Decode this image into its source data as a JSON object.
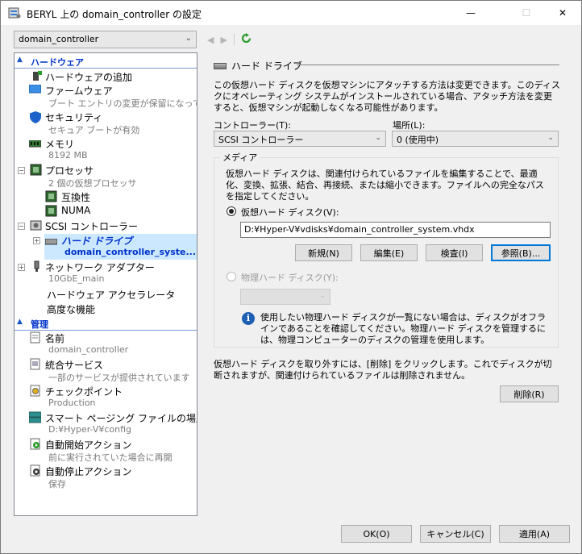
{
  "window": {
    "title": "BERYL 上の domain_controller の設定",
    "minimize": "—",
    "maximize": "☐",
    "close": "✕"
  },
  "vm_select": {
    "value": "domain_controller"
  },
  "tree": {
    "hardware_header": "ハードウェア",
    "management_header": "管理",
    "items": {
      "add_hardware": {
        "name": "ハードウェアの追加"
      },
      "firmware": {
        "name": "ファームウェア",
        "sub": "ブート エントリの変更が保留になって..."
      },
      "security": {
        "name": "セキュリティ",
        "sub": "セキュア ブートが有効"
      },
      "memory": {
        "name": "メモリ",
        "sub": "8192 MB"
      },
      "processor": {
        "name": "プロセッサ",
        "sub": "2 個の仮想プロセッサ"
      },
      "compat": {
        "name": "互換性"
      },
      "numa": {
        "name": "NUMA"
      },
      "scsi": {
        "name": "SCSI コントローラー"
      },
      "hdd": {
        "name": "ハード ドライブ",
        "sub": "domain_controller_syste..."
      },
      "nic": {
        "name": "ネットワーク アダプター",
        "sub": "10GbE_main"
      },
      "hw_accel": {
        "name": "ハードウェア アクセラレータ"
      },
      "advanced": {
        "name": "高度な機能"
      },
      "vm_name": {
        "name": "名前",
        "sub": "domain_controller"
      },
      "integration": {
        "name": "統合サービス",
        "sub": "一部のサービスが提供されています"
      },
      "checkpoint": {
        "name": "チェックポイント",
        "sub": "Production"
      },
      "paging": {
        "name": "スマート ページング ファイルの場所",
        "sub": "D:¥Hyper-V¥config"
      },
      "autostart": {
        "name": "自動開始アクション",
        "sub": "前に実行されていた場合に再開"
      },
      "autostop": {
        "name": "自動停止アクション",
        "sub": "保存"
      }
    }
  },
  "panel": {
    "title": "ハード ドライブ",
    "description": "この仮想ハード ディスクを仮想マシンにアタッチする方法は変更できます。このディスクにオペレーティング システムがインストールされている場合、アタッチ方法を変更すると、仮想マシンが起動しなくなる可能性があります。",
    "controller_label": "コントローラー(T):",
    "controller_value": "SCSI コントローラー",
    "location_label": "場所(L):",
    "location_value": "0 (使用中)",
    "media_legend": "メディア",
    "media_desc": "仮想ハード ディスクは、関連付けられているファイルを編集することで、最適化、変換、拡張、結合、再接続、または縮小できます。ファイルへの完全なパスを指定してください。",
    "vhd_radio": "仮想ハード ディスク(V):",
    "vhd_path": "D:¥Hyper-V¥vdisks¥domain_controller_system.vhdx",
    "btn_new": "新規(N)",
    "btn_edit": "編集(E)",
    "btn_inspect": "検査(I)",
    "btn_browse": "参照(B)...",
    "phys_radio": "物理ハード ディスク(Y):",
    "info_text": "使用したい物理ハード ディスクが一覧にない場合は、ディスクがオフラインであることを確認してください。物理ハード ディスクを管理するには、物理コンピューターのディスクの管理を使用します。",
    "remove_text": "仮想ハード ディスクを取り外すには、[削除] をクリックします。これでディスクが切断されますが、関連付けられているファイルは削除されません。",
    "btn_remove": "削除(R)"
  },
  "footer": {
    "ok": "OK(O)",
    "cancel": "キャンセル(C)",
    "apply": "適用(A)"
  }
}
